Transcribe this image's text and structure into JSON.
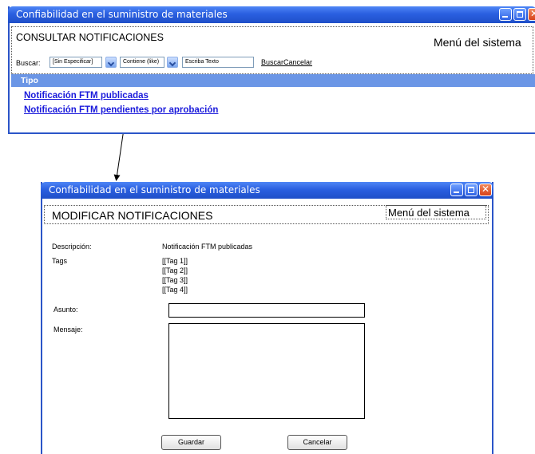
{
  "window1": {
    "title": "Confiabilidad en el suministro de materiales",
    "heading": "CONSULTAR NOTIFICACIONES",
    "system_menu": "Menú del sistema",
    "search": {
      "label": "Buscar:",
      "field_select": "[Sin Especificar]",
      "operator_select": "Contiene (like)",
      "text_placeholder": "Escriba Texto",
      "search_link": "Buscar",
      "cancel_link": "Cancelar"
    },
    "table": {
      "column_header": "Tipo",
      "rows": [
        "Notificación FTM publicadas",
        "Notificación FTM pendientes por aprobación"
      ]
    }
  },
  "window2": {
    "title": "Confiabilidad en el suministro de materiales",
    "heading": "MODIFICAR NOTIFICACIONES",
    "system_menu": "Menú del sistema",
    "description_label": "Descripción:",
    "description_value": "Notificación FTM publicadas",
    "tags_label": "Tags",
    "tags": [
      "[[Tag 1]]",
      "[[Tag 2]]",
      "[[Tag 3]]",
      "[[Tag 4]]"
    ],
    "subject_label": "Asunto:",
    "subject_value": "",
    "message_label": "Mensaje:",
    "message_value": "",
    "save_button": "Guardar",
    "cancel_button": "Cancelar"
  },
  "colors": {
    "titlebar": "#2a5fe0",
    "column_header": "#6b96e6",
    "link": "#1a1adb",
    "close_button": "#d8421a"
  },
  "icons": [
    "minimize-icon",
    "maximize-icon",
    "close-icon",
    "chevron-down-icon"
  ]
}
